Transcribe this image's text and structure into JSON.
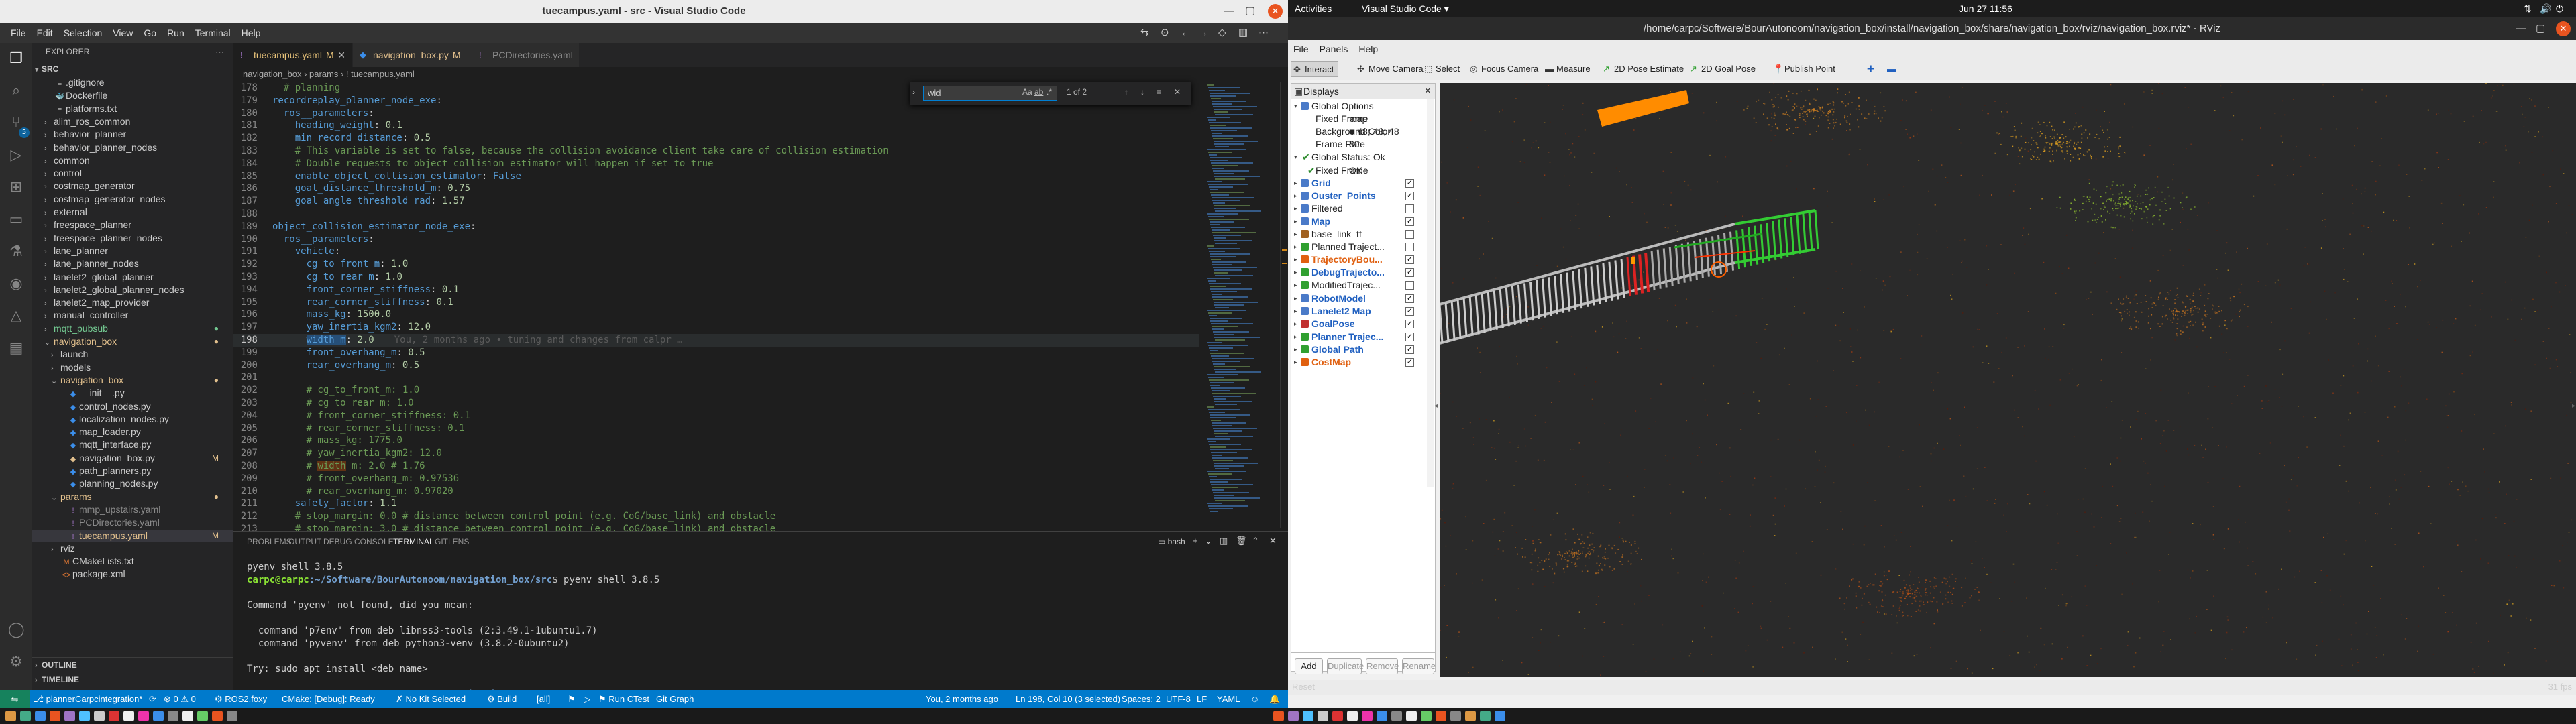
{
  "vscode": {
    "window_title": "tuecampus.yaml - src - Visual Studio Code",
    "menu": [
      "File",
      "Edit",
      "Selection",
      "View",
      "Go",
      "Run",
      "Terminal",
      "Help"
    ],
    "explorer_header": "EXPLORER",
    "root_folder": "SRC",
    "tree": [
      {
        "label": ".gitignore",
        "icon": "≡",
        "color": "#a0a0a0",
        "indent": 1
      },
      {
        "label": "Dockerfile",
        "icon": "🐳",
        "color": "#4fc1ff",
        "indent": 1
      },
      {
        "label": "platforms.txt",
        "icon": "≡",
        "color": "#a0a0a0",
        "indent": 1
      },
      {
        "label": "alim_ros_common",
        "folder": true,
        "indent": 1
      },
      {
        "label": "behavior_planner",
        "folder": true,
        "indent": 1
      },
      {
        "label": "behavior_planner_nodes",
        "folder": true,
        "indent": 1
      },
      {
        "label": "common",
        "folder": true,
        "indent": 1
      },
      {
        "label": "control",
        "folder": true,
        "indent": 1
      },
      {
        "label": "costmap_generator",
        "folder": true,
        "indent": 1
      },
      {
        "label": "costmap_generator_nodes",
        "folder": true,
        "indent": 1
      },
      {
        "label": "external",
        "folder": true,
        "indent": 1
      },
      {
        "label": "freespace_planner",
        "folder": true,
        "indent": 1
      },
      {
        "label": "freespace_planner_nodes",
        "folder": true,
        "indent": 1
      },
      {
        "label": "lane_planner",
        "folder": true,
        "indent": 1
      },
      {
        "label": "lane_planner_nodes",
        "folder": true,
        "indent": 1
      },
      {
        "label": "lanelet2_global_planner",
        "folder": true,
        "indent": 1
      },
      {
        "label": "lanelet2_global_planner_nodes",
        "folder": true,
        "indent": 1
      },
      {
        "label": "lanelet2_map_provider",
        "folder": true,
        "indent": 1
      },
      {
        "label": "manual_controller",
        "folder": true,
        "indent": 1
      },
      {
        "label": "mqtt_pubsub",
        "folder": true,
        "indent": 1,
        "color": "#73c991",
        "mark": "●"
      },
      {
        "label": "navigation_box",
        "folder": true,
        "open": true,
        "indent": 1,
        "color": "#e2c08d",
        "mark": "●"
      },
      {
        "label": "launch",
        "folder": true,
        "indent": 2
      },
      {
        "label": "models",
        "folder": true,
        "indent": 2
      },
      {
        "label": "navigation_box",
        "folder": true,
        "open": true,
        "indent": 2,
        "color": "#e2c08d",
        "mark": "●"
      },
      {
        "label": "__init__.py",
        "icon": "◆",
        "color": "#3b8eea",
        "indent": 3
      },
      {
        "label": "control_nodes.py",
        "icon": "◆",
        "color": "#3b8eea",
        "indent": 3
      },
      {
        "label": "localization_nodes.py",
        "icon": "◆",
        "color": "#3b8eea",
        "indent": 3
      },
      {
        "label": "map_loader.py",
        "icon": "◆",
        "color": "#3b8eea",
        "indent": 3
      },
      {
        "label": "mqtt_interface.py",
        "icon": "◆",
        "color": "#3b8eea",
        "indent": 3
      },
      {
        "label": "navigation_box.py",
        "icon": "◆",
        "color": "#e2c08d",
        "indent": 3,
        "mark": "M"
      },
      {
        "label": "path_planners.py",
        "icon": "◆",
        "color": "#3b8eea",
        "indent": 3
      },
      {
        "label": "planning_nodes.py",
        "icon": "◆",
        "color": "#3b8eea",
        "indent": 3
      },
      {
        "label": "params",
        "folder": true,
        "open": true,
        "indent": 2,
        "color": "#e2c08d",
        "mark": "●"
      },
      {
        "label": "mmp_upstairs.yaml",
        "icon": "!",
        "color": "#a074c4",
        "indent": 3,
        "text": "#8b8b8b"
      },
      {
        "label": "PCDirectories.yaml",
        "icon": "!",
        "color": "#a074c4",
        "indent": 3,
        "text": "#8b8b8b"
      },
      {
        "label": "tuecampus.yaml",
        "icon": "!",
        "color": "#a074c4",
        "indent": 3,
        "mark": "M",
        "text": "#e2c08d",
        "selected": true
      },
      {
        "label": "rviz",
        "folder": true,
        "indent": 2
      },
      {
        "label": "CMakeLists.txt",
        "icon": "M",
        "color": "#e37933",
        "indent": 2
      },
      {
        "label": "package.xml",
        "icon": "<>",
        "color": "#e37933",
        "indent": 2
      }
    ],
    "outline": "OUTLINE",
    "timeline": "TIMELINE",
    "tabs": [
      {
        "label": "tuecampus.yaml",
        "mod": "M",
        "icon": "!",
        "active": true
      },
      {
        "label": "navigation_box.py",
        "mod": "M",
        "icon": "◆"
      },
      {
        "label": "PCDirectories.yaml",
        "mod": "",
        "icon": "!"
      }
    ],
    "breadcrumb": "navigation_box  ›  params  ›  ! tuecampus.yaml",
    "find": {
      "query": "wid",
      "result": "1 of 2",
      "aa": "Aa",
      "ab": "ab",
      "re": ".*"
    },
    "code_lines": [
      {
        "n": "178",
        "html": "<span class='c'>  # planning</span>"
      },
      {
        "n": "179",
        "html": "<span class='k'>recordreplay_planner_node_exe</span><span class='d'>:</span>"
      },
      {
        "n": "180",
        "html": "  <span class='k'>ros__parameters</span><span class='d'>:</span>"
      },
      {
        "n": "181",
        "html": "    <span class='k'>heading_weight</span><span class='d'>: </span><span class='v'>0.1</span>"
      },
      {
        "n": "182",
        "html": "    <span class='k'>min_record_distance</span><span class='d'>: </span><span class='v'>0.5</span>"
      },
      {
        "n": "183",
        "html": "    <span class='c'># This variable is set to false, because the collision avoidance client take care of collision estimation</span>"
      },
      {
        "n": "184",
        "html": "    <span class='c'># Double requests to object collision estimator will happen if set to true</span>"
      },
      {
        "n": "185",
        "html": "    <span class='k'>enable_object_collision_estimator</span><span class='d'>: </span><span class='k'>False</span>"
      },
      {
        "n": "186",
        "html": "    <span class='k'>goal_distance_threshold_m</span><span class='d'>: </span><span class='v'>0.75</span>"
      },
      {
        "n": "187",
        "html": "    <span class='k'>goal_angle_threshold_rad</span><span class='d'>: </span><span class='v'>1.57</span>"
      },
      {
        "n": "188",
        "html": ""
      },
      {
        "n": "189",
        "html": "<span class='k'>object_collision_estimator_node_exe</span><span class='d'>:</span>"
      },
      {
        "n": "190",
        "html": "  <span class='k'>ros__parameters</span><span class='d'>:</span>"
      },
      {
        "n": "191",
        "html": "    <span class='k'>vehicle</span><span class='d'>:</span>"
      },
      {
        "n": "192",
        "html": "      <span class='k'>cg_to_front_m</span><span class='d'>: </span><span class='v'>1.0</span>"
      },
      {
        "n": "193",
        "html": "      <span class='k'>cg_to_rear_m</span><span class='d'>: </span><span class='v'>1.0</span>"
      },
      {
        "n": "194",
        "html": "      <span class='k'>front_corner_stiffness</span><span class='d'>: </span><span class='v'>0.1</span>"
      },
      {
        "n": "195",
        "html": "      <span class='k'>rear_corner_stiffness</span><span class='d'>: </span><span class='v'>0.1</span>"
      },
      {
        "n": "196",
        "html": "      <span class='k'>mass_kg</span><span class='d'>: </span><span class='v'>1500.0</span>"
      },
      {
        "n": "197",
        "html": "      <span class='k'>yaw_inertia_kgm2</span><span class='d'>: </span><span class='v'>12.0</span>"
      },
      {
        "n": "198",
        "html": "      <span class='k' style='background:#264f78'>width_m</span><span class='d'>: </span><span class='v'>2.0</span><span class='blame'>You, 2 months ago • tuning and changes from calpr …</span>",
        "cur": true
      },
      {
        "n": "199",
        "html": "      <span class='k'>front_overhang_m</span><span class='d'>: </span><span class='v'>0.5</span>"
      },
      {
        "n": "200",
        "html": "      <span class='k'>rear_overhang_m</span><span class='d'>: </span><span class='v'>0.5</span>"
      },
      {
        "n": "201",
        "html": ""
      },
      {
        "n": "202",
        "html": "      <span class='c'># cg_to_front_m: 1.0</span>"
      },
      {
        "n": "203",
        "html": "      <span class='c'># cg_to_rear_m: 1.0</span>"
      },
      {
        "n": "204",
        "html": "      <span class='c'># front_corner_stiffness: 0.1</span>"
      },
      {
        "n": "205",
        "html": "      <span class='c'># rear_corner_stiffness: 0.1</span>"
      },
      {
        "n": "206",
        "html": "      <span class='c'># mass_kg: 1775.0</span>"
      },
      {
        "n": "207",
        "html": "      <span class='c'># yaw_inertia_kgm2: 12.0</span>"
      },
      {
        "n": "208",
        "html": "      <span class='c'># <span style='background:#613214'>width</span>_m: 2.0 # 1.76</span>"
      },
      {
        "n": "209",
        "html": "      <span class='c'># front_overhang_m: 0.97536</span>"
      },
      {
        "n": "210",
        "html": "      <span class='c'># rear_overhang_m: 0.97020</span>"
      },
      {
        "n": "211",
        "html": "    <span class='k'>safety_factor</span><span class='d'>: </span><span class='v'>1.1</span>"
      },
      {
        "n": "212",
        "html": "    <span class='c'># stop_margin: 0.0 # distance between control point (e.g. CoG/base_link) and obstacle</span>"
      },
      {
        "n": "213",
        "html": "    <span class='c'># stop_margin: 3.0 # distance between control point (e.g. CoG/base_link) and obstacle</span>"
      }
    ],
    "panel_tabs": [
      "PROBLEMS",
      "OUTPUT",
      "DEBUG CONSOLE",
      "TERMINAL",
      "GITLENS"
    ],
    "panel_active": "TERMINAL",
    "terminal_shell": "bash",
    "terminal": [
      {
        "t": "pyenv shell 3.8.5"
      },
      {
        "prompt": true,
        "user": "carpc@carpc",
        "path": ":~/Software/BourAutonoom/navigation_box/src",
        "cmd": "$ pyenv shell 3.8.5"
      },
      {
        "t": ""
      },
      {
        "t": "Command 'pyenv' not found, did you mean:"
      },
      {
        "t": ""
      },
      {
        "t": "  command 'p7env' from deb libnss3-tools (2:3.49.1-1ubuntu1.7)"
      },
      {
        "t": "  command 'pyvenv' from deb python3-venv (3.8.2-0ubuntu2)"
      },
      {
        "t": ""
      },
      {
        "t": "Try: sudo apt install <deb name>"
      },
      {
        "t": ""
      },
      {
        "prompt": true,
        "user": "carpc@carpc",
        "path": ":~/Software/BourAutonoom/navigation_box/src",
        "cmd": "$ ▯"
      }
    ],
    "status": {
      "branch": "⎇ plannerCarpcintegration*",
      "sync": "⟳",
      "errors": "⊗ 0 ⚠ 0",
      "ros": "⚙ ROS2.foxy",
      "cmake": "CMake: [Debug]: Ready",
      "kit": "✗ No Kit Selected",
      "build": "⚙ Build",
      "alltarget": "[all]",
      "ctest": "⚑ Run CTest",
      "git_graph": "Git Graph",
      "blame": "You, 2 months ago",
      "pos": "Ln 198, Col 10 (3 selected)",
      "spaces": "Spaces: 2",
      "enc": "UTF-8",
      "eol": "LF",
      "lang": "YAML"
    }
  },
  "rviz": {
    "activities": "Activities",
    "app_menu": "Visual Studio Code ▾",
    "clock": "Jun 27  11:56",
    "window_title": "/home/carpc/Software/BourAutonoom/navigation_box/install/navigation_box/share/navigation_box/rviz/navigation_box.rviz* - RViz",
    "menu": [
      "File",
      "Panels",
      "Help"
    ],
    "tools": [
      {
        "label": "Interact",
        "icon": "✥",
        "active": true
      },
      {
        "label": "Move Camera",
        "icon": "✣"
      },
      {
        "label": "Select",
        "icon": "⬚"
      },
      {
        "label": "Focus Camera",
        "icon": "◎"
      },
      {
        "label": "Measure",
        "icon": "▬"
      },
      {
        "label": "2D Pose Estimate",
        "icon": "↗"
      },
      {
        "label": "2D Goal Pose",
        "icon": "↗"
      },
      {
        "label": "Publish Point",
        "icon": "📍"
      },
      {
        "label": "",
        "icon": "✚"
      },
      {
        "label": "",
        "icon": "▬"
      }
    ],
    "displays_title": "Displays",
    "display_rows": [
      {
        "label": "Global Options",
        "level": 0,
        "exp": "▾",
        "icon": "#4a7ac8"
      },
      {
        "label": "Fixed Frame",
        "value": "map",
        "level": 1
      },
      {
        "label": "Background Color",
        "value": "■ 48; 48; 48",
        "level": 1
      },
      {
        "label": "Frame Rate",
        "value": "30",
        "level": 1
      },
      {
        "label": "Global Status: Ok",
        "level": 0,
        "exp": "▾",
        "check": "✔"
      },
      {
        "label": "Fixed Frame",
        "value": "OK",
        "level": 1,
        "check": "✔"
      },
      {
        "label": "Grid",
        "level": 0,
        "exp": "▸",
        "cls": "blue",
        "icon": "#4a7ac8",
        "cb": true
      },
      {
        "label": "Ouster_Points",
        "level": 0,
        "exp": "▸",
        "cls": "blue",
        "icon": "#4a7ac8",
        "cb": true
      },
      {
        "label": "Filtered",
        "level": 0,
        "exp": "▸",
        "icon": "#4a7ac8",
        "cb": false
      },
      {
        "label": "Map",
        "level": 0,
        "exp": "▸",
        "cls": "blue",
        "icon": "#4a7ac8",
        "cb": true
      },
      {
        "label": "base_link_tf",
        "level": 0,
        "exp": "▸",
        "icon": "#a06020",
        "cb": false
      },
      {
        "label": "Planned Traject...",
        "level": 0,
        "exp": "▸",
        "icon": "#30a030",
        "cb": false
      },
      {
        "label": "TrajectoryBou...",
        "level": 0,
        "exp": "▸",
        "cls": "orange",
        "icon": "#e06010",
        "cb": true
      },
      {
        "label": "DebugTrajecto...",
        "level": 0,
        "exp": "▸",
        "cls": "blue",
        "icon": "#30a030",
        "cb": true
      },
      {
        "label": "ModifiedTrajec...",
        "level": 0,
        "exp": "▸",
        "icon": "#30a030",
        "cb": false
      },
      {
        "label": "RobotModel",
        "level": 0,
        "exp": "▸",
        "cls": "blue",
        "icon": "#4a7ac8",
        "cb": true
      },
      {
        "label": "Lanelet2 Map",
        "level": 0,
        "exp": "▸",
        "cls": "blue",
        "icon": "#4a7ac8",
        "cb": true
      },
      {
        "label": "GoalPose",
        "level": 0,
        "exp": "▸",
        "cls": "blue",
        "icon": "#c03030",
        "cb": true
      },
      {
        "label": "Planner Trajec...",
        "level": 0,
        "exp": "▸",
        "cls": "blue",
        "icon": "#30a030",
        "cb": true
      },
      {
        "label": "Global Path",
        "level": 0,
        "exp": "▸",
        "cls": "blue",
        "icon": "#30a030",
        "cb": true
      },
      {
        "label": "CostMap",
        "level": 0,
        "exp": "▸",
        "cls": "orange",
        "icon": "#e06010",
        "cb": true
      }
    ],
    "buttons": {
      "add": "Add",
      "duplicate": "Duplicate",
      "remove": "Remove",
      "rename": "Rename"
    },
    "reset": "Reset",
    "fps": "31 fps"
  }
}
